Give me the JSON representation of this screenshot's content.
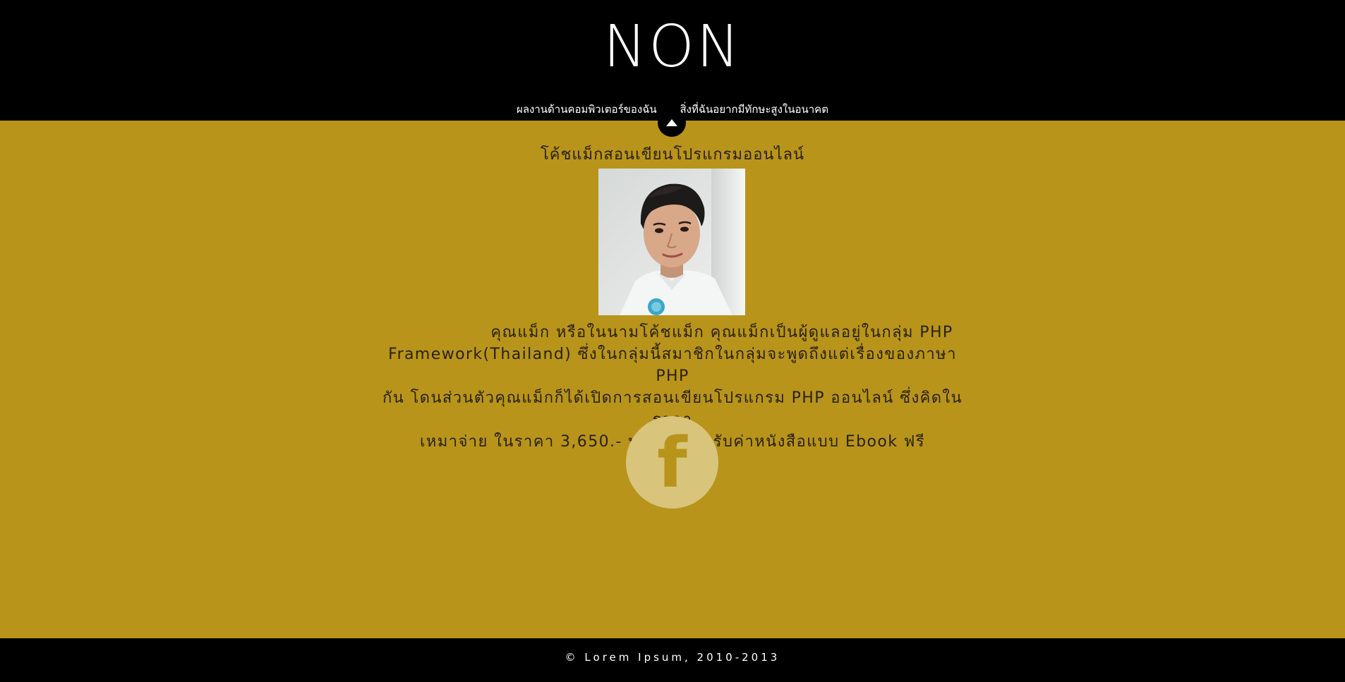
{
  "header": {
    "logo": "NON",
    "nav": [
      {
        "label": "ผลงานด้านคอมพิวเตอร์ของฉัน"
      },
      {
        "label": "สิ่งที่ฉันอยากมีทักษะสูงในอนาคต"
      }
    ]
  },
  "main": {
    "title": "โค้ชแม็กสอนเขียนโปรแกรมออนไลน์",
    "bio_lines": [
      "คุณแม็ก หรือในนามโค้ชแม็ก คุณแม็กเป็นผู้ดูแลอยู่ในกลุ่ม PHP",
      "Framework(Thailand) ซึ่งในกลุ่มนี้สมาชิกในกลุ่มจะพูดถึงแต่เรื่องของภาษา PHP",
      "กัน โดนส่วนตัวคุณแม็กก็ได้เปิดการสอนเขียนโปรแกรม PHP ออนไลน์ ซึ่งคิดในราคา",
      "เหมาจ่าย ในราคา 3,650.- บาท/ปี สำหรับค่าหนังสือแบบ Ebook ฟรี"
    ],
    "social_icon": "facebook-icon",
    "social_glyph": "f"
  },
  "footer": {
    "copyright": "© Lorem Ipsum, 2010-2013"
  },
  "colors": {
    "header_bg": "#000000",
    "main_bg": "#b8941b",
    "text": "#2a210a",
    "social_circle": "#d9c47c"
  }
}
